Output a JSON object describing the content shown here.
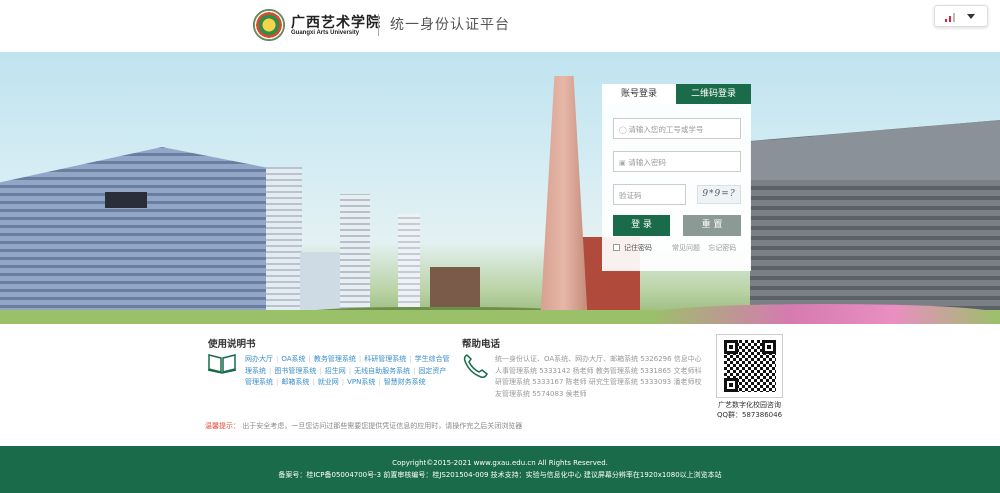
{
  "header": {
    "logo_cn": "广西艺术学院",
    "logo_en": "Guangxi Arts University",
    "system_title": "统一身份认证平台"
  },
  "login": {
    "tab_account": "账号登录",
    "tab_qrcode": "二维码登录",
    "username_placeholder": "请输入您的工号或学号",
    "password_placeholder": "请输入密码",
    "captcha_placeholder": "验证码",
    "captcha_text": "9*9=?",
    "login_button": "登 录",
    "reset_button": "重 置",
    "remember_label": "记住密码",
    "faq_link": "常见问题",
    "forgot_link": "忘记密码"
  },
  "manual": {
    "title": "使用说明书",
    "links": [
      "网办大厅",
      "OA系统",
      "教务管理系统",
      "科研管理系统",
      "学生综合管理系统",
      "图书管理系统",
      "招生网",
      "无线自助服务系统",
      "固定资产管理系统",
      "邮箱系统",
      "就业网",
      "VPN系统",
      "智慧财务系统"
    ]
  },
  "helpline": {
    "title": "帮助电话",
    "text": "统一身份认证、OA系统、网办大厅、邮箱系统 5326296 信息中心人事管理系统 5333142 杨老师   教务管理系统 5331865 文老师科研管理系统 5333167 陈老师   研究生管理系统 5333093 潘老师校友管理系统 5574083 侯老师"
  },
  "qr": {
    "caption": "广艺数字化校园咨询",
    "qq": "QQ群：587386046"
  },
  "notice": {
    "label": "温馨提示：",
    "text": "出于安全考虑，一旦您访问过那些需要您提供凭证信息的应用时，请操作完之后关闭浏览器"
  },
  "footer": {
    "copyright": "Copyright©2015-2021 www.gxau.edu.cn All Rights Reserved.",
    "record": "备案号：桂ICP备05004700号-3 前置审核编号：桂JS201504-009 技术支持：实验与信息化中心 建议屏幕分辨率在1920x1080以上浏览本站"
  },
  "colors": {
    "brand_green": "#1a6b4a",
    "link_blue": "#3a8ec8",
    "notice_red": "#e04a3a"
  }
}
